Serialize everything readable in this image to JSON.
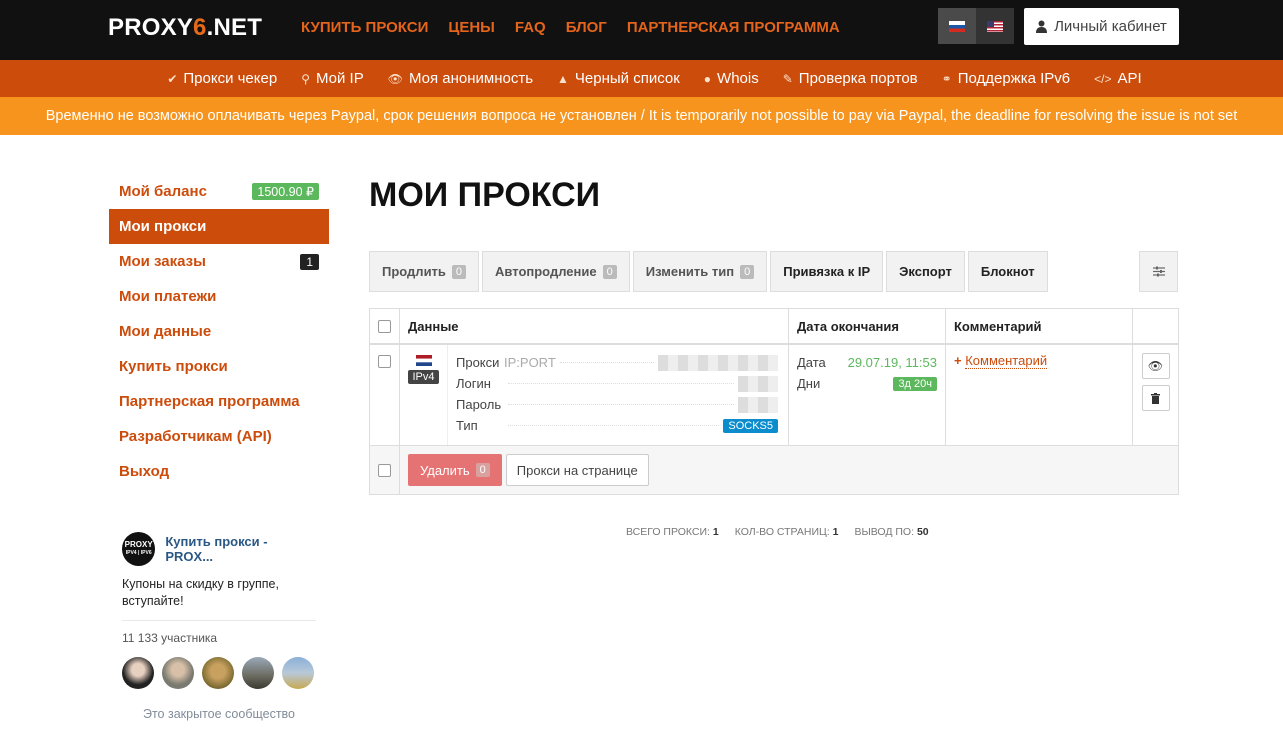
{
  "header": {
    "logo_pre": "PROXY",
    "logo_six": "6",
    "logo_post": ".NET",
    "nav": [
      "КУПИТЬ ПРОКСИ",
      "ЦЕНЫ",
      "FAQ",
      "БЛОГ",
      "ПАРТНЕРСКАЯ ПРОГРАММА"
    ],
    "cabinet_label": "Личный кабинет"
  },
  "subnav": [
    {
      "icon": "check-circle-icon",
      "label": "Прокси чекер"
    },
    {
      "icon": "map-marker-icon",
      "label": "Мой IP"
    },
    {
      "icon": "eye-icon",
      "label": "Моя анонимность"
    },
    {
      "icon": "warning-icon",
      "label": "Черный список"
    },
    {
      "icon": "globe-icon",
      "label": "Whois"
    },
    {
      "icon": "plug-icon",
      "label": "Проверка портов"
    },
    {
      "icon": "link-icon",
      "label": "Поддержка IPv6"
    },
    {
      "icon": "code-icon",
      "label": "API"
    }
  ],
  "alert": "Временно не возможно оплачивать через Paypal, срок решения вопроса не установлен / It is temporarily not possible to pay via Paypal, the deadline for resolving the issue is not set",
  "sidebar": {
    "items": [
      {
        "label": "Мой баланс",
        "badge": "1500.90 ₽"
      },
      {
        "label": "Мои прокси",
        "badge": ""
      },
      {
        "label": "Мои заказы",
        "badge": "1"
      },
      {
        "label": "Мои платежи",
        "badge": ""
      },
      {
        "label": "Мои данные",
        "badge": ""
      },
      {
        "label": "Купить прокси",
        "badge": ""
      },
      {
        "label": "Партнерская программа",
        "badge": ""
      },
      {
        "label": "Разработчикам (API)",
        "badge": ""
      },
      {
        "label": "Выход",
        "badge": ""
      }
    ]
  },
  "vk": {
    "logo_line1": "PROXY",
    "logo_line2": "IPV4 | IPV6",
    "title": "Купить прокси - PROX...",
    "text": "Купоны на скидку в группе, вступайте!",
    "members": "11 133 участника",
    "closed": "Это закрытое сообщество"
  },
  "main": {
    "title": "МОИ ПРОКСИ",
    "toolbar": [
      {
        "label": "Продлить",
        "count": "0"
      },
      {
        "label": "Автопродление",
        "count": "0"
      },
      {
        "label": "Изменить тип",
        "count": "0"
      },
      {
        "label": "Привязка к IP",
        "count": ""
      },
      {
        "label": "Экспорт",
        "count": ""
      },
      {
        "label": "Блокнот",
        "count": ""
      }
    ],
    "table": {
      "headers": [
        "Данные",
        "Дата окончания",
        "Комментарий"
      ],
      "row": {
        "ip_version": "IPv4",
        "proxy_label": "Прокси",
        "proxy_hint": "IP:PORT",
        "login_label": "Логин",
        "password_label": "Пароль",
        "type_label": "Тип",
        "type_value": "SOCKS5",
        "date_label": "Дата",
        "date_value": "29.07.19, 11:53",
        "days_label": "Дни",
        "days_value": "3д 20ч",
        "comment_link": "Комментарий"
      },
      "footer": {
        "delete_label": "Удалить",
        "delete_count": "0",
        "per_page_label": "Прокси на странице"
      }
    },
    "stats": {
      "total_label": "ВСЕГО ПРОКСИ:",
      "total_value": "1",
      "pages_label": "КОЛ-ВО СТРАНИЦ:",
      "pages_value": "1",
      "per_label": "ВЫВОД ПО:",
      "per_value": "50"
    }
  }
}
